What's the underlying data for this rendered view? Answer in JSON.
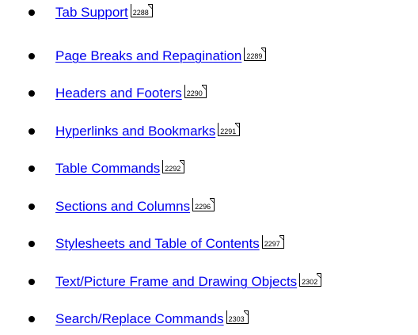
{
  "topics": [
    {
      "label": "Tab Support",
      "page": "2288"
    },
    {
      "label": "Page Breaks and Repagination",
      "page": "2289"
    },
    {
      "label": "Headers and Footers",
      "page": "2290"
    },
    {
      "label": "Hyperlinks and Bookmarks",
      "page": "2291"
    },
    {
      "label": "Table Commands",
      "page": "2292"
    },
    {
      "label": "Sections and Columns",
      "page": "2296"
    },
    {
      "label": "Stylesheets and Table of Contents",
      "page": "2297"
    },
    {
      "label": "Text/Picture Frame and Drawing Objects",
      "page": "2302"
    },
    {
      "label": "Search/Replace Commands",
      "page": "2303"
    }
  ],
  "colors": {
    "link": "#0000ee",
    "bullet": "#000000",
    "background": "#ffffff"
  },
  "icons": {
    "bullet": "bullet-dot-icon",
    "page_ref": "page-reference-icon"
  }
}
